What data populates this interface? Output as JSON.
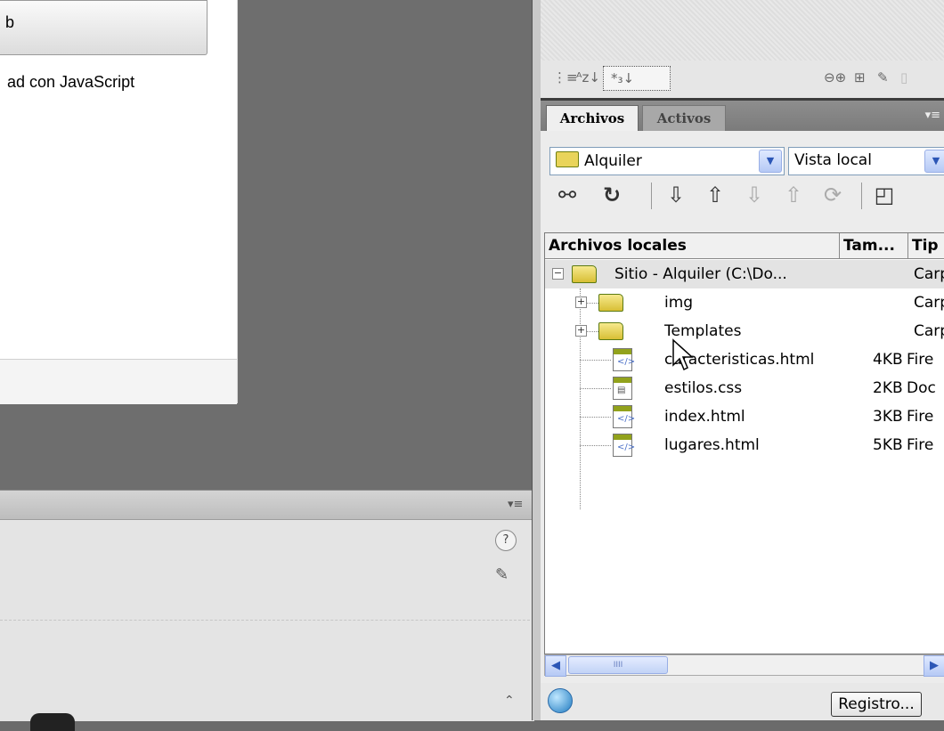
{
  "document": {
    "button_label_fragment": "b",
    "text_fragment": "ad con JavaScript"
  },
  "bottom_panel": {
    "menu_icon": "panel-menu-icon",
    "help_icon": "help-icon",
    "edit_icon": "edit-tag-icon",
    "expand_icon": "expand-up-icon"
  },
  "right_panel": {
    "props_icons": [
      "list-view-icon",
      "sort-az-icon",
      "selected-attributes-icon",
      "link-icon",
      "new-attribute-icon",
      "edit-pencil-icon"
    ],
    "tabs": [
      {
        "label": "Archivos",
        "active": true
      },
      {
        "label": "Activos",
        "active": false
      }
    ],
    "site_combo": {
      "value": "Alquiler"
    },
    "view_combo": {
      "value": "Vista local"
    },
    "toolbar": [
      "connect-icon",
      "refresh-icon",
      "get-down-icon",
      "put-up-icon",
      "checkout-icon",
      "checkin-icon",
      "synchronize-icon",
      "expand-panel-icon"
    ],
    "table": {
      "columns": [
        "Archivos locales",
        "Tam...",
        "Tip"
      ],
      "rows": [
        {
          "name": "Sitio - Alquiler (C:\\Do...",
          "size": "",
          "type": "Carp",
          "kind": "site"
        },
        {
          "name": "img",
          "size": "",
          "type": "Carp",
          "kind": "folder"
        },
        {
          "name": "Templates",
          "size": "",
          "type": "Carp",
          "kind": "folder"
        },
        {
          "name": "caracteristicas.html",
          "size": "4KB",
          "type": "Fire",
          "kind": "html"
        },
        {
          "name": "estilos.css",
          "size": "2KB",
          "type": "Doc",
          "kind": "css"
        },
        {
          "name": "index.html",
          "size": "3KB",
          "type": "Fire",
          "kind": "html"
        },
        {
          "name": "lugares.html",
          "size": "5KB",
          "type": "Fire",
          "kind": "html"
        }
      ]
    },
    "scrollbar_grip": "IIII",
    "status": {
      "registro_label": "Registro..."
    }
  },
  "colors": {
    "tab_active": "#efefef",
    "tab_bar": "#7b7b7b",
    "folder": "#e9d45a"
  }
}
